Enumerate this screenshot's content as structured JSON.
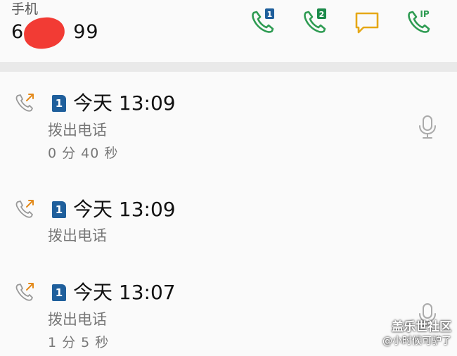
{
  "contact": {
    "label": "手机",
    "number_prefix": "6",
    "number_suffix": "99"
  },
  "actions": {
    "call_sim1_badge": "1",
    "call_sim2_badge": "2",
    "ip_call_badge": "IP"
  },
  "colors": {
    "call_green": "#2e9b52",
    "message_yellow": "#e6a817",
    "outgoing_arrow": "#e38a1c",
    "sim1_blue": "#1f5f9c",
    "sim2_green": "#1c8a4a"
  },
  "records": [
    {
      "icon": "outgoing-call-icon",
      "sim": "1",
      "time": "今天 13:09",
      "type": "拨出电话",
      "duration": "0 分 40 秒",
      "has_recording": true
    },
    {
      "icon": "outgoing-call-icon",
      "sim": "1",
      "time": "今天 13:09",
      "type": "拨出电话",
      "duration": "",
      "has_recording": false
    },
    {
      "icon": "outgoing-call-icon",
      "sim": "1",
      "time": "今天 13:07",
      "type": "拨出电话",
      "duration": "1 分 5 秒",
      "has_recording": true
    }
  ],
  "watermark": {
    "line1": "盖乐世社区",
    "line2": "@小时候可驴了"
  }
}
